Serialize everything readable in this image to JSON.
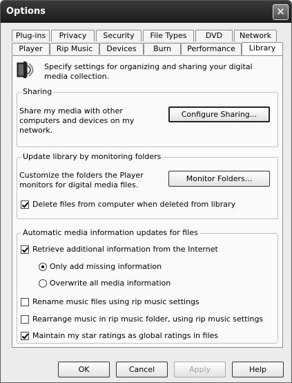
{
  "window": {
    "title": "Options"
  },
  "tabs": {
    "row1": [
      "Plug-ins",
      "Privacy",
      "Security",
      "File Types",
      "DVD",
      "Network"
    ],
    "row2": [
      "Player",
      "Rip Music",
      "Devices",
      "Burn",
      "Performance",
      "Library"
    ],
    "active": "Library"
  },
  "header": {
    "text": "Specify settings for organizing and sharing your digital media collection."
  },
  "sharing": {
    "title": "Sharing",
    "description": "Share my media with other computers and devices on my network.",
    "button": "Configure Sharing..."
  },
  "monitoring": {
    "title": "Update library by monitoring folders",
    "description": "Customize the folders the Player monitors for digital media files.",
    "button": "Monitor Folders...",
    "delete_files": {
      "label": "Delete files from computer when deleted from library",
      "checked": true
    }
  },
  "auto_updates": {
    "title": "Automatic media information updates for files",
    "retrieve": {
      "label": "Retrieve additional information from the Internet",
      "checked": true
    },
    "only_missing": {
      "label": "Only add missing information",
      "selected": true
    },
    "overwrite": {
      "label": "Overwrite all media information",
      "selected": false
    },
    "rename": {
      "label": "Rename music files using rip music settings",
      "checked": false
    },
    "rearrange": {
      "label": "Rearrange music in rip music folder, using rip music settings",
      "checked": false
    },
    "star_ratings": {
      "label": "Maintain my star ratings as global ratings in files",
      "checked": true
    }
  },
  "buttons": {
    "ok": "OK",
    "cancel": "Cancel",
    "apply": "Apply",
    "help": "Help"
  },
  "icons": {
    "close": "close-icon",
    "library": "library-icon"
  }
}
